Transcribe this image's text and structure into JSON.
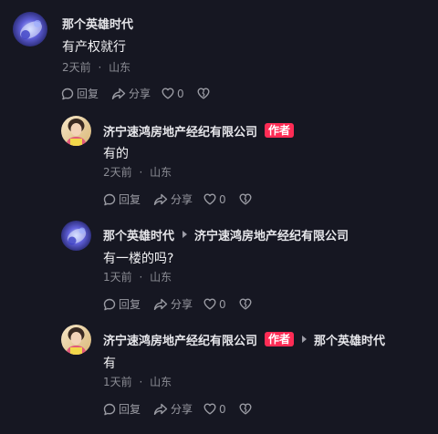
{
  "comments": [
    {
      "user": "那个英雄时代",
      "content": "有产权就行",
      "time": "2天前",
      "location": "山东",
      "reply_label": "回复",
      "share_label": "分享",
      "likes": "0"
    },
    {
      "user": "济宁速鸿房地产经纪有限公司",
      "badge": "作者",
      "content": "有的",
      "time": "2天前",
      "location": "山东",
      "reply_label": "回复",
      "share_label": "分享",
      "likes": "0"
    },
    {
      "user": "那个英雄时代",
      "reply_to": "济宁速鸿房地产经纪有限公司",
      "content": "有一楼的吗?",
      "time": "1天前",
      "location": "山东",
      "reply_label": "回复",
      "share_label": "分享",
      "likes": "0"
    },
    {
      "user": "济宁速鸿房地产经纪有限公司",
      "badge": "作者",
      "reply_to": "那个英雄时代",
      "content": "有",
      "time": "1天前",
      "location": "山东",
      "reply_label": "回复",
      "share_label": "分享",
      "likes": "0"
    }
  ],
  "meta_separator": "·",
  "icons": {
    "reply": "reply-bubble-icon",
    "share": "share-arrow-icon",
    "like": "heart-icon",
    "dislike": "broken-heart-icon"
  },
  "colors": {
    "background": "#161722",
    "badge": "#fe2c55",
    "muted": "#8a8b93"
  }
}
